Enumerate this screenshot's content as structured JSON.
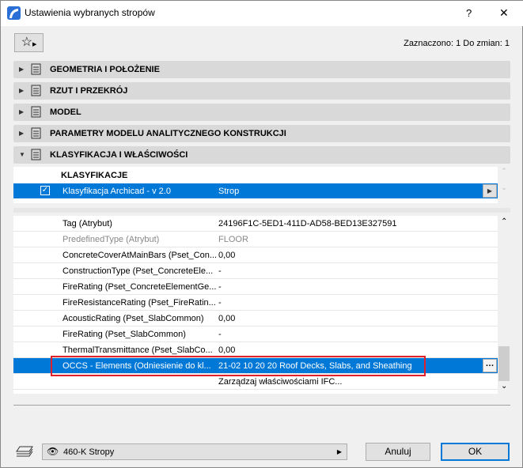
{
  "window": {
    "title": "Ustawienia wybranych stropów",
    "help": "?",
    "close": "✕"
  },
  "status": "Zaznaczono: 1 Do zmian: 1",
  "sections": [
    {
      "label": "GEOMETRIA I POŁOŻENIE",
      "icon": "geometry-icon",
      "expanded": false
    },
    {
      "label": "RZUT I PRZEKRÓJ",
      "icon": "floorplan-section-icon",
      "expanded": false
    },
    {
      "label": "MODEL",
      "icon": "model-icon",
      "expanded": false
    },
    {
      "label": "PARAMETRY MODELU ANALITYCZNEGO KONSTRUKCJI",
      "icon": "structural-analytical-icon",
      "expanded": false
    },
    {
      "label": "KLASYFIKACJA I WŁAŚCIWOŚCI",
      "icon": "document-icon",
      "expanded": true
    }
  ],
  "classification": {
    "header": "KLASYFIKACJE",
    "row": {
      "checked": true,
      "name": "Klasyfikacja Archicad - v 2.0",
      "value": "Strop"
    }
  },
  "properties": [
    {
      "key": "Tag (Atrybut)",
      "value": "24196F1C-5ED1-411D-AD58-BED13E327591",
      "disabled": false
    },
    {
      "key": "PredefinedType (Atrybut)",
      "value": "FLOOR",
      "disabled": true
    },
    {
      "key": "ConcreteCoverAtMainBars (Pset_Con...",
      "value": "0,00"
    },
    {
      "key": "ConstructionType (Pset_ConcreteEle...",
      "value": "-"
    },
    {
      "key": "FireRating (Pset_ConcreteElementGe...",
      "value": "-"
    },
    {
      "key": "FireResistanceRating (Pset_FireRatin...",
      "value": "-"
    },
    {
      "key": "AcousticRating (Pset_SlabCommon)",
      "value": "0,00"
    },
    {
      "key": "FireRating (Pset_SlabCommon)",
      "value": "-"
    },
    {
      "key": "ThermalTransmittance (Pset_SlabCo...",
      "value": "0,00"
    },
    {
      "key": "OCCS - Elements (Odniesienie do kl...",
      "value": "21-02 10 20 20 Roof Decks, Slabs, and Sheathing",
      "selected": true
    },
    {
      "key": "",
      "value": "Zarządzaj właściwościami IFC..."
    }
  ],
  "footer": {
    "layer": "460-K Stropy",
    "cancel": "Anuluj",
    "ok": "OK"
  },
  "colors": {
    "selection": "#0078d7",
    "highlight_box": "#e0202a"
  }
}
